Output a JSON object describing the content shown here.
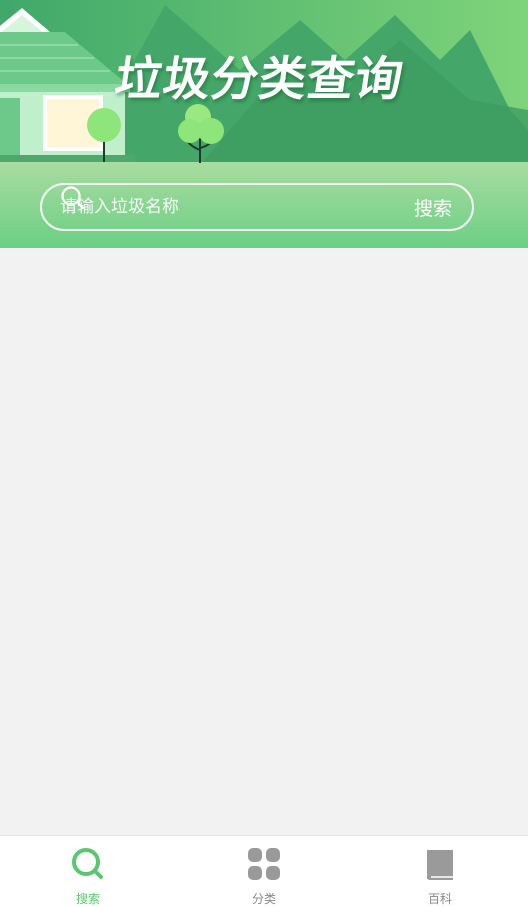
{
  "header": {
    "title": "垃圾分类查询"
  },
  "search": {
    "placeholder": "请输入垃圾名称",
    "button_label": "搜索"
  },
  "tabbar": {
    "active_color": "#58c76d",
    "inactive_color": "#888888",
    "items": [
      {
        "label": "搜索",
        "icon": "search-icon",
        "active": true
      },
      {
        "label": "分类",
        "icon": "grid-icon",
        "active": false
      },
      {
        "label": "百科",
        "icon": "book-icon",
        "active": false
      }
    ]
  }
}
